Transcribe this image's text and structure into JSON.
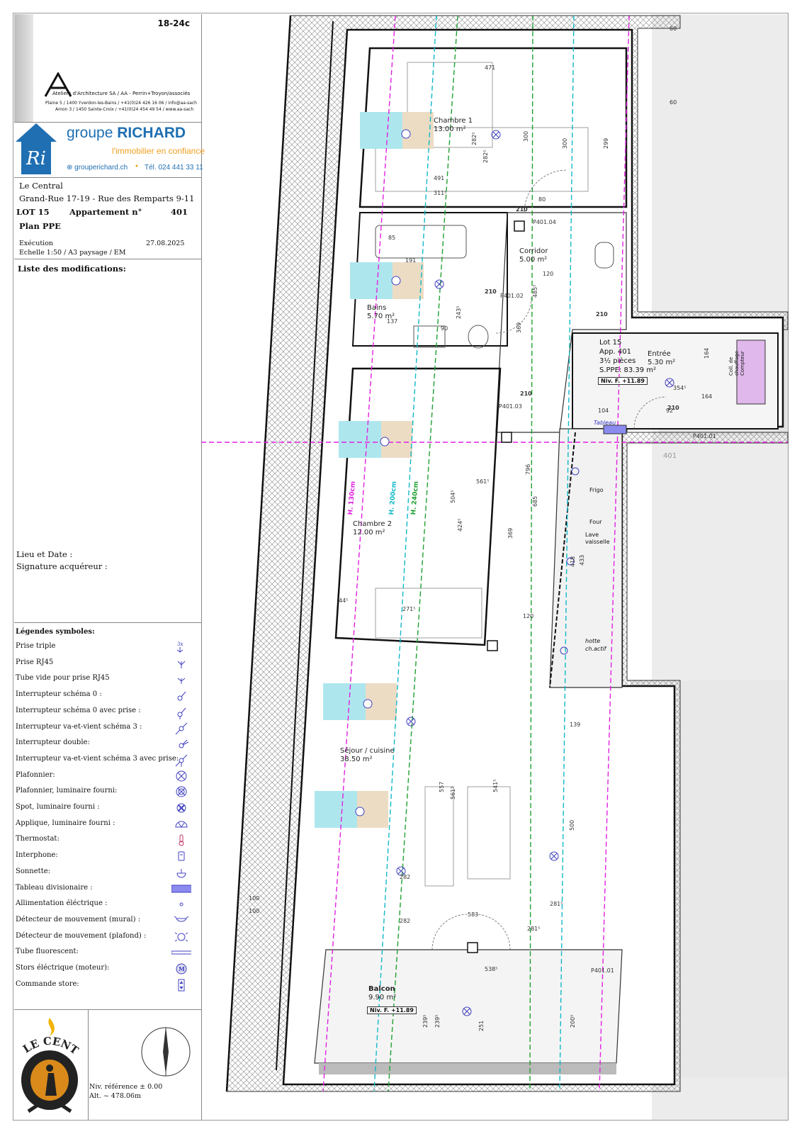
{
  "sheet_code": "18-24c",
  "architect": {
    "name_line": "Ateliers d'Architecture SA / AA - Perrin+Troyon/associés",
    "address1": "Plaine 5 / 1400 Yverdon-les-Bains / +41(0)24 426 16 06 / info@aa-sach",
    "address2": "Amon 3 / 1450 Sainte-Croix / +41(0)24 454 49 54 / www.aa-sach"
  },
  "promoter": {
    "brand_groupe": "groupe",
    "brand_name": "RICHARD",
    "tagline": "l'immobilier en confiance",
    "website": "⊕ grouperichard.ch",
    "bullet": "•",
    "phone": "Tél. 024 441 33 11"
  },
  "project": {
    "name": "Le Central",
    "address": "Grand-Rue 17-19 - Rue des Remparts 9-11",
    "lot_label": "LOT 15",
    "apt_label": "Appartement n°",
    "apt_number": "401",
    "plan_type": "Plan PPE",
    "phase": "Exécution",
    "date": "27.08.2025",
    "scale": "Echelle 1:50 / A3 paysage / EM"
  },
  "modifications_title": "Liste des modifications:",
  "signature": {
    "place_date": "Lieu et Date :",
    "signature": "Signature acquéreur :"
  },
  "legend": {
    "title": "Légendes symboles:",
    "items": [
      {
        "label": "Prise triple",
        "icon": "triple-socket-icon"
      },
      {
        "label": "Prise RJ45",
        "icon": "rj45-socket-icon"
      },
      {
        "label": "Tube vide pour prise RJ45",
        "icon": "empty-tube-icon"
      },
      {
        "label": "Interrupteur schéma 0 :",
        "icon": "switch-0-icon"
      },
      {
        "label": "Interrupteur schéma 0 avec prise :",
        "icon": "switch-0-socket-icon"
      },
      {
        "label": "Interrupteur va-et-vient schéma 3 :",
        "icon": "two-way-switch-icon"
      },
      {
        "label": "Interrupteur double:",
        "icon": "double-switch-icon"
      },
      {
        "label": "Interrupteur va-et-vient schéma 3 avec prise:",
        "icon": "two-way-switch-socket-icon"
      },
      {
        "label": "Plafonnier:",
        "icon": "ceiling-light-icon"
      },
      {
        "label": "Plafonnier, luminaire fourni:",
        "icon": "ceiling-light-supplied-icon"
      },
      {
        "label": "Spot, luminaire fourni :",
        "icon": "spot-icon"
      },
      {
        "label": "Applique, luminaire fourni :",
        "icon": "wall-light-icon"
      },
      {
        "label": "Thermostat:",
        "icon": "thermostat-icon"
      },
      {
        "label": "Interphone:",
        "icon": "intercom-icon"
      },
      {
        "label": "Sonnette:",
        "icon": "doorbell-icon"
      },
      {
        "label": "Tableau divisionaire :",
        "icon": "distribution-board-icon"
      },
      {
        "label": "Allimentation éléctrique :",
        "icon": "power-supply-icon"
      },
      {
        "label": "Détecteur de mouvement (mural) :",
        "icon": "wall-motion-detector-icon"
      },
      {
        "label": "Détecteur de mouvement (plafond) :",
        "icon": "ceiling-motion-detector-icon"
      },
      {
        "label": "Tube fluorescent:",
        "icon": "fluorescent-tube-icon"
      },
      {
        "label": "Stors éléctrique (moteur):",
        "icon": "blind-motor-icon"
      },
      {
        "label": "Commande store:",
        "icon": "blind-control-icon"
      }
    ]
  },
  "footer": {
    "logo_text": "LE CENTRAL",
    "ref_level": "Niv. référence ± 0.00",
    "altitude": "Alt. ~ 478.06m"
  },
  "plan": {
    "rooms": [
      {
        "name": "Chambre 1",
        "area": "13.00 m²"
      },
      {
        "name": "Corridor",
        "area": "5.00 m²"
      },
      {
        "name": "Bains",
        "area": "5.70 m²"
      },
      {
        "name": "Entrée",
        "area": "5.30 m²"
      },
      {
        "name": "Chambre 2",
        "area": "12.00 m²"
      },
      {
        "name": "Séjour / cuisine",
        "area": "38.50 m²"
      },
      {
        "name": "Balcon",
        "area": "9.90 m²"
      }
    ],
    "lot_info": {
      "lot": "Lot 15",
      "app": "App. 401",
      "pieces": "3½ pièces",
      "sppe": "S.PPE: 83.39 m²"
    },
    "level_tag": "Niv. F. +11.89",
    "door_height": "210",
    "kitchen_labels": {
      "frigo": "Frigo",
      "four": "Four",
      "lave": "Lave",
      "vaisselle": "vaisselle",
      "hotte": "hotte",
      "charbon": "ch.actif"
    },
    "tableau": "Tableau",
    "chauffage": "Coll. de chauffage Compteur",
    "heights": {
      "h130": "H. 130cm",
      "h200": "H. 200cm",
      "h240": "H. 240cm"
    },
    "dims": [
      "300",
      "300",
      "299",
      "471",
      "491",
      "311⁵",
      "282⁵",
      "282⁵",
      "80",
      "85",
      "191",
      "137",
      "90",
      "120",
      "369",
      "485⁵",
      "243⁵",
      "796",
      "685",
      "561⁵",
      "504⁵",
      "424⁵",
      "369",
      "271⁵",
      "120",
      "139",
      "557",
      "561⁵",
      "541⁵",
      "500",
      "433",
      "418",
      "282",
      "282",
      "583",
      "281⁵",
      "281⁵",
      "538⁵",
      "251",
      "239⁵",
      "239⁵",
      "200⁵",
      "104",
      "92",
      "354⁵",
      "164",
      "164",
      "60",
      "60",
      "44⁵",
      "100",
      "100"
    ],
    "axis_label": "401",
    "p_tags": [
      "P401.04",
      "P401.01",
      "P401.01",
      "P401.02",
      "P401.03"
    ]
  }
}
